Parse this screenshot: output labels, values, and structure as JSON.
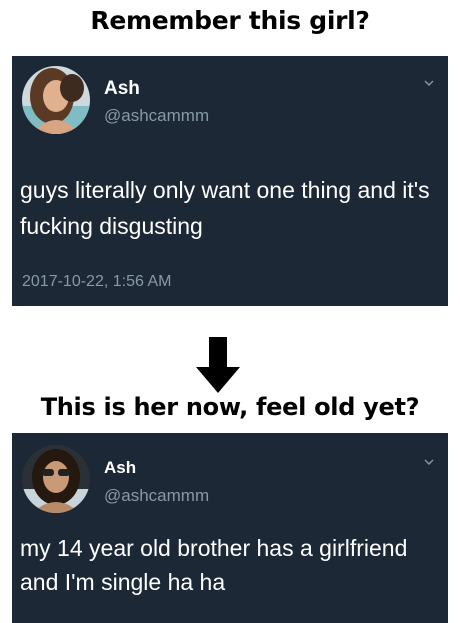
{
  "captions": {
    "top": "Remember this girl?",
    "middle": "This is her now, feel old yet?"
  },
  "tweets": [
    {
      "name": "Ash",
      "handle": "@ashcammm",
      "text": "guys literally only want one thing and it's fucking disgusting",
      "timestamp": "2017-10-22, 1:56 AM"
    },
    {
      "name": "Ash",
      "handle": "@ashcammm",
      "text": "my 14 year old brother has a girlfriend and I'm single ha ha"
    }
  ],
  "colors": {
    "tweet_background": "#1c2836",
    "secondary_text": "#8899a6",
    "caption_text": "#000000"
  },
  "icons": [
    "chevron-down-icon",
    "down-arrow-icon",
    "avatar"
  ]
}
